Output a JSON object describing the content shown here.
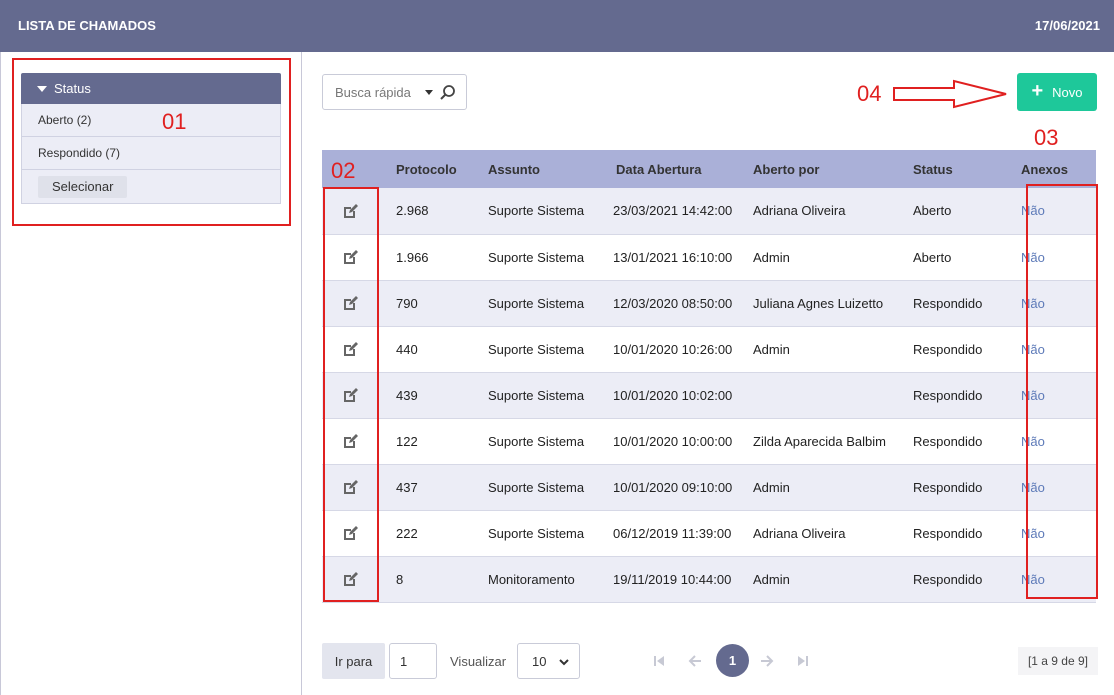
{
  "header": {
    "title": "LISTA DE CHAMADOS",
    "date": "17/06/2021"
  },
  "sidebar": {
    "filter_title": "Status",
    "items": [
      {
        "label": "Aberto (2)"
      },
      {
        "label": "Respondido (7)"
      }
    ],
    "select_button": "Selecionar"
  },
  "search": {
    "placeholder": "Busca rápida",
    "icon": "search-icon"
  },
  "new_button": {
    "label": "Novo",
    "icon": "plus-icon"
  },
  "table": {
    "headers": {
      "protocolo": "Protocolo",
      "assunto": "Assunto",
      "data": "Data Abertura",
      "aberto_por": "Aberto por",
      "status": "Status",
      "anexos": "Anexos"
    },
    "rows": [
      {
        "protocolo": "2.968",
        "assunto": "Suporte Sistema",
        "data": "23/03/2021 14:42:00",
        "aberto_por": "Adriana Oliveira",
        "status": "Aberto",
        "anexos": "Não"
      },
      {
        "protocolo": "1.966",
        "assunto": "Suporte Sistema",
        "data": "13/01/2021 16:10:00",
        "aberto_por": "Admin",
        "status": "Aberto",
        "anexos": "Não"
      },
      {
        "protocolo": "790",
        "assunto": "Suporte Sistema",
        "data": "12/03/2020 08:50:00",
        "aberto_por": "Juliana Agnes Luizetto",
        "status": "Respondido",
        "anexos": "Não"
      },
      {
        "protocolo": "440",
        "assunto": "Suporte Sistema",
        "data": "10/01/2020 10:26:00",
        "aberto_por": "Admin",
        "status": "Respondido",
        "anexos": "Não"
      },
      {
        "protocolo": "439",
        "assunto": "Suporte Sistema",
        "data": "10/01/2020 10:02:00",
        "aberto_por": "",
        "status": "Respondido",
        "anexos": "Não"
      },
      {
        "protocolo": "122",
        "assunto": "Suporte Sistema",
        "data": "10/01/2020 10:00:00",
        "aberto_por": "Zilda Aparecida Balbim",
        "status": "Respondido",
        "anexos": "Não"
      },
      {
        "protocolo": "437",
        "assunto": "Suporte Sistema",
        "data": "10/01/2020 09:10:00",
        "aberto_por": "Admin",
        "status": "Respondido",
        "anexos": "Não"
      },
      {
        "protocolo": "222",
        "assunto": "Suporte Sistema",
        "data": "06/12/2019 11:39:00",
        "aberto_por": "Adriana Oliveira",
        "status": "Respondido",
        "anexos": "Não"
      },
      {
        "protocolo": "8",
        "assunto": "Monitoramento",
        "data": "19/11/2019 10:44:00",
        "aberto_por": "Admin",
        "status": "Respondido",
        "anexos": "Não"
      }
    ]
  },
  "pagination": {
    "goto_label": "Ir para",
    "goto_value": "1",
    "view_label": "Visualizar",
    "per_page": "10",
    "current_page": "1",
    "range": "[1 a 9 de 9]"
  },
  "annotations": {
    "a01": "01",
    "a02": "02",
    "a03": "03",
    "a04": "04"
  },
  "colors": {
    "header_bg": "#646a8f",
    "accent_green": "#1ec89a",
    "annotation_red": "#e02020",
    "status_open": "#a11a1a"
  }
}
